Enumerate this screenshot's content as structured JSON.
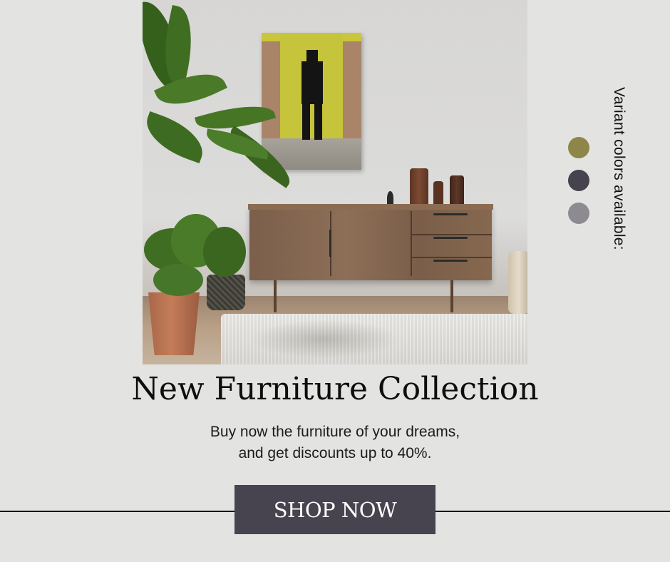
{
  "promo": {
    "headline": "New Furniture Collection",
    "subtext_line1": "Buy now the furniture of your dreams,",
    "subtext_line2": "and get discounts up to 40%.",
    "cta_label": "SHOP NOW",
    "variant_label": "Variant colors available:"
  },
  "variants": [
    {
      "name": "olive",
      "color": "#8e8548"
    },
    {
      "name": "charcoal",
      "color": "#46434e"
    },
    {
      "name": "grey",
      "color": "#8d8a91"
    }
  ],
  "colors": {
    "background": "#e3e4e2",
    "button": "#47444f"
  }
}
